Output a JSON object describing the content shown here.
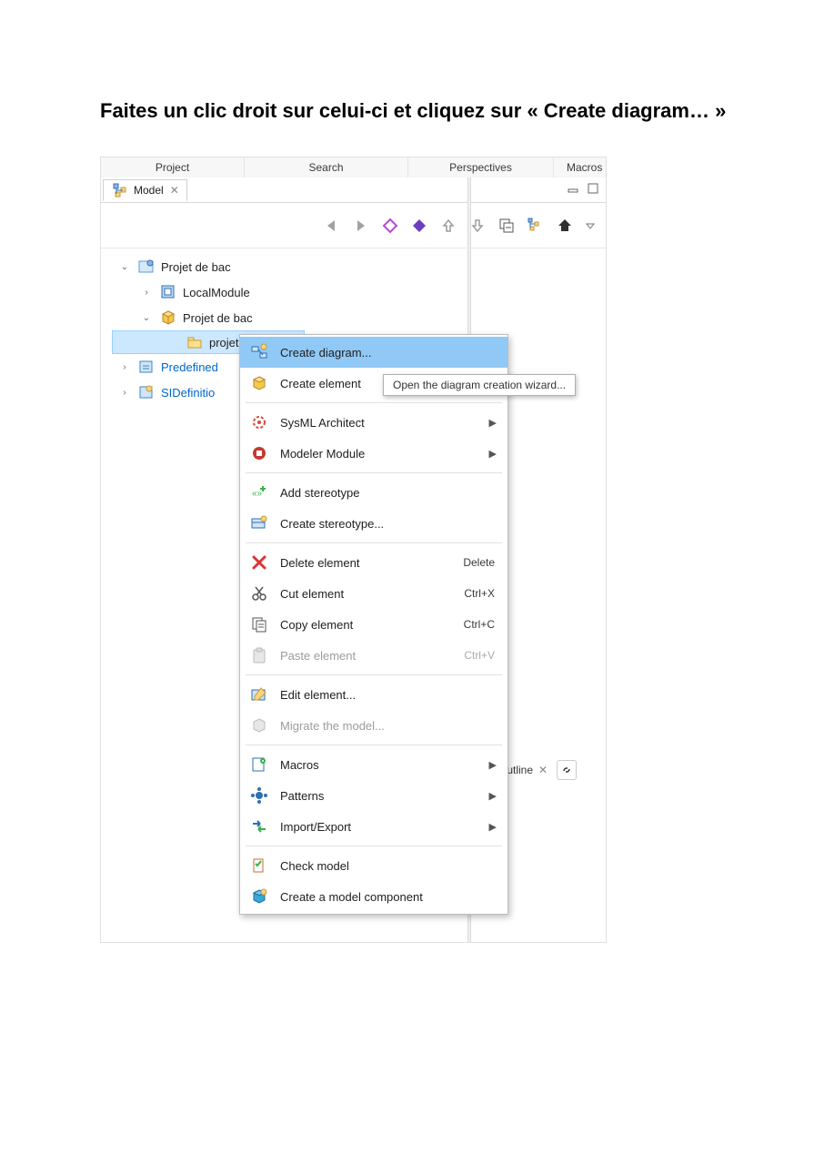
{
  "instruction_text": "Faites un clic droit sur celui-ci et cliquez sur « Create diagram… »",
  "menus": {
    "project": "Project",
    "search": "Search",
    "perspectives": "Perspectives",
    "macros": "Macros"
  },
  "panel": {
    "model_tab": "Model",
    "outline_tab": "Outline"
  },
  "tree": {
    "root": "Projet de bac",
    "local_module": "LocalModule",
    "proj2": "Projet de bac",
    "folder": "projet de bac",
    "predefined": "Predefined",
    "sidef": "SIDefinitio"
  },
  "context_menu": {
    "create_diagram": "Create diagram...",
    "create_element": "Create element",
    "sysml_architect": "SysML Architect",
    "modeler_module": "Modeler Module",
    "add_stereotype": "Add stereotype",
    "create_stereotype": "Create stereotype...",
    "delete_element": "Delete element",
    "cut_element": "Cut element",
    "copy_element": "Copy element",
    "paste_element": "Paste element",
    "edit_element": "Edit element...",
    "migrate_model": "Migrate the model...",
    "macros": "Macros",
    "patterns": "Patterns",
    "import_export": "Import/Export",
    "check_model": "Check model",
    "create_component": "Create a model component",
    "shortcut_delete": "Delete",
    "shortcut_cut": "Ctrl+X",
    "shortcut_copy": "Ctrl+C",
    "shortcut_paste": "Ctrl+V"
  },
  "tooltip": "Open the diagram creation wizard..."
}
